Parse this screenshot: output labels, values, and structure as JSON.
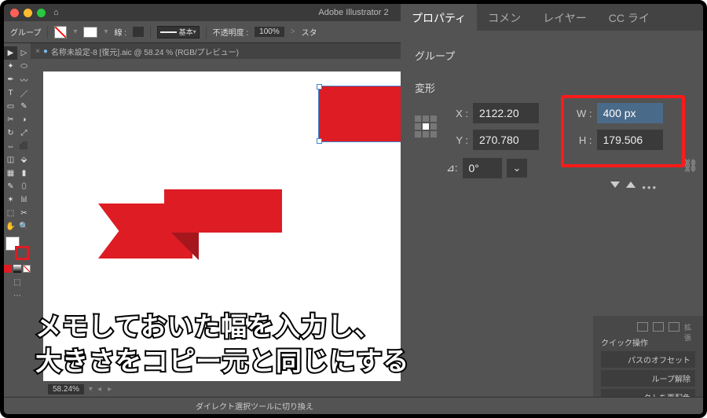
{
  "app": {
    "title": "Adobe Illustrator 2"
  },
  "titlebar_home": "⌂",
  "control_bar": {
    "object_label": "グループ",
    "stroke_label": "線 :",
    "opacity_label": "不透明度 :",
    "opacity_value": "100%",
    "style_label": "スタ",
    "basic_label": "基本"
  },
  "doc_tab": "名称未設定-8 [復元].aic @ 58.24 % (RGB/プレビュー)",
  "tools": [
    [
      "▶",
      "▷"
    ],
    [
      "⬚",
      "✦"
    ],
    [
      "T",
      "／"
    ],
    [
      "▭",
      "✎"
    ],
    [
      "✂",
      "◑"
    ],
    [
      "↻",
      "�låll"
    ],
    [
      "⇔",
      "⬛"
    ],
    [
      "✎",
      "〰"
    ],
    [
      "◫",
      "lıl"
    ],
    [
      "⯐",
      "🔍"
    ]
  ],
  "panel": {
    "tabs": {
      "properties": "プロパティ",
      "comment": "コメン",
      "layers": "レイヤー",
      "cclib": "CC ライ"
    },
    "selection_type": "グループ",
    "transform_label": "変形",
    "x_label": "X :",
    "x_value": "2122.20",
    "y_label": "Y :",
    "y_value": "270.780",
    "w_label": "W :",
    "w_value": "400 px",
    "h_label": "H :",
    "h_value": "179.506",
    "angle_label": "⊿:",
    "angle_value": "0°"
  },
  "quick": {
    "title": "クイック操作",
    "items": [
      "パスのオフセット",
      "ループ解除",
      "クトを再配色"
    ],
    "expand_label": "拡張"
  },
  "zoom": {
    "value": "58.24%"
  },
  "statusbar": {
    "hint": "ダイレクト選択ツールに切り換え"
  },
  "overlay": {
    "line1": "メモしておいた幅を入力し、",
    "line2": "大きさをコピー元と同じにする"
  }
}
